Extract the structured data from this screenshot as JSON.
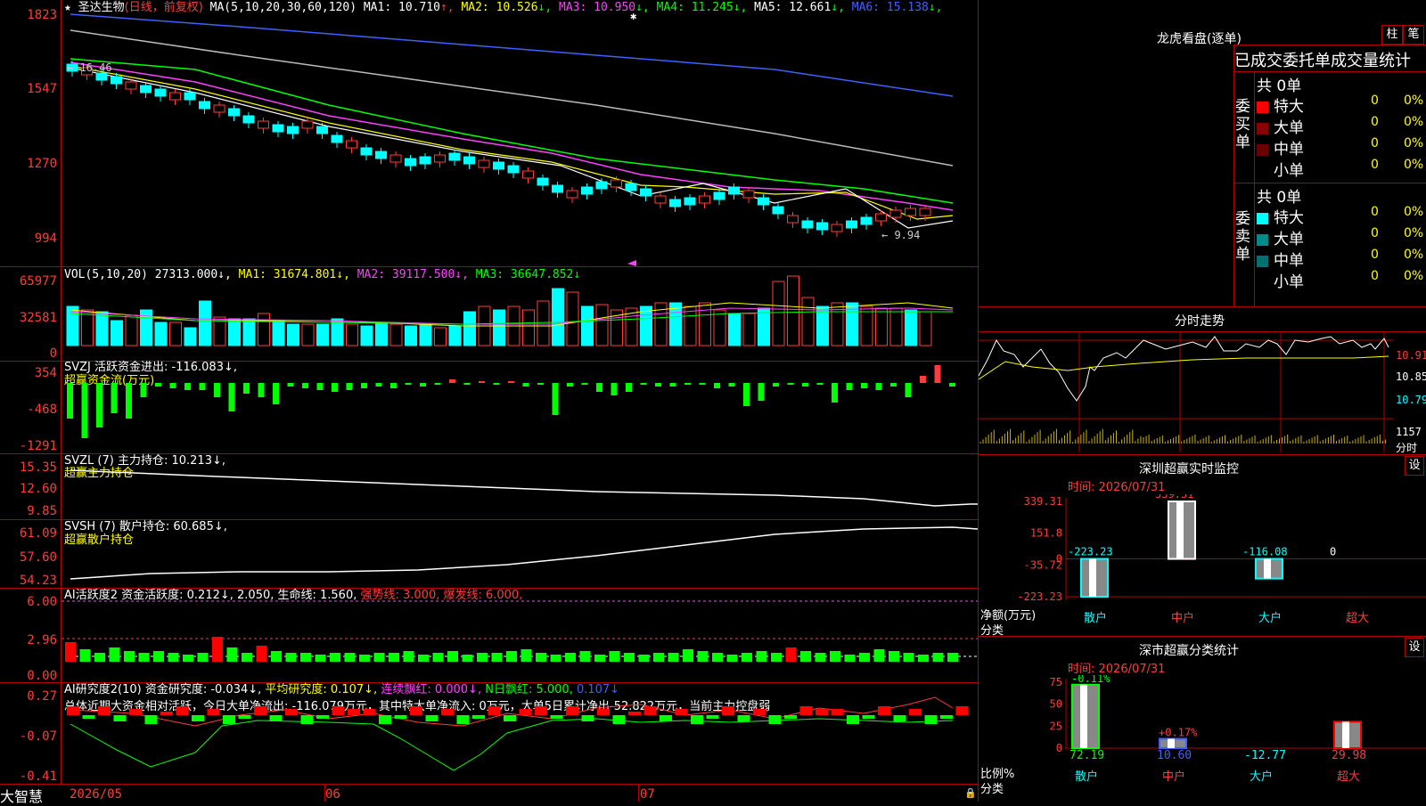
{
  "app": {
    "name": "大智慧"
  },
  "main_chart": {
    "title_prefix": "★",
    "stock": "圣达生物",
    "period": "(日线，前复权)",
    "ma_label": "MA(5,10,20,30,60,120)",
    "ma": [
      {
        "label": "MA1: 10.710",
        "arrow": "↑",
        "color": "#ffffff"
      },
      {
        "label": "MA2: 10.526",
        "arrow": "↓",
        "color": "#ffff00"
      },
      {
        "label": "MA3: 10.950",
        "arrow": "↓",
        "color": "#ff40ff"
      },
      {
        "label": "MA4: 11.245",
        "arrow": "↓",
        "color": "#00ff00"
      },
      {
        "label": "MA5: 12.661",
        "arrow": "↓",
        "color": "#ffffff"
      },
      {
        "label": "MA6: 15.138",
        "arrow": "↓",
        "color": "#4060ff"
      }
    ],
    "y_ticks": [
      "1823",
      "1547",
      "1270",
      "994"
    ],
    "high_label": "16.46",
    "low_label": "9.94"
  },
  "volume": {
    "header": "VOL(5,10,20) 27313.000↓,",
    "ma1": "MA1: 31674.801↓,",
    "ma2": "MA2: 39117.500↓,",
    "ma3": "MA3: 36647.852↓",
    "y_ticks": [
      "65977",
      "32581",
      "0"
    ]
  },
  "svzj": {
    "header": "SVZJ  活跃资金进出: -116.083↓,",
    "sub": "超赢资金流(万元)",
    "y_ticks": [
      "354",
      "-468",
      "-1291"
    ]
  },
  "svzl": {
    "header": "SVZL (7) 主力持仓: 10.213↓,",
    "sub": "超赢主力持仓",
    "y_ticks": [
      "15.35",
      "12.60",
      "9.85"
    ]
  },
  "svsh": {
    "header": "SVSH (7) 散户持仓: 60.685↓,",
    "sub": "超赢散户持仓",
    "y_ticks": [
      "61.09",
      "57.60",
      "54.23"
    ]
  },
  "ai_active": {
    "header_a": "AI活跃度2 资金活跃度: 0.212↓, 2.050, 生命线: 1.560,",
    "header_b": "强势线: 3.000, 爆发线: 6.000,",
    "y_ticks": [
      "6.00",
      "2.96",
      "0.00"
    ]
  },
  "ai_research": {
    "header_a": "AI研究度2(10) 资金研究度: -0.034↓,",
    "header_b": "平均研究度: 0.107↓,",
    "header_c": "连续飘红: 0.000↓,",
    "header_d": "N日飘红: 5.000,",
    "header_e": "0.107↓",
    "summary": "总体近期大资金相对活跃，今日大单净流出: -116.079万元，其中特大单净流入: 0万元，大单5日累计净出-52.822万元，当前主力控盘弱",
    "y_ticks": [
      "0.27",
      "-0.07",
      "-0.41"
    ]
  },
  "x_axis": {
    "labels": [
      "2026/05",
      "06",
      "07"
    ]
  },
  "lhb": {
    "title": "龙虎看盘(逐单)",
    "btn_zhu": "柱",
    "btn_bi": "笔",
    "subtitle": "已成交委托单成交量统计",
    "buy": {
      "side": "委买单",
      "total": "共 0单",
      "rows": [
        {
          "label": "特大",
          "val": "0",
          "pct": "0%",
          "color": "#ff0000"
        },
        {
          "label": "大单",
          "val": "0",
          "pct": "0%",
          "color": "#8b0000"
        },
        {
          "label": "中单",
          "val": "0",
          "pct": "0%",
          "color": "#6a0000"
        },
        {
          "label": "小单",
          "val": "0",
          "pct": "0%",
          "color": "#000000"
        }
      ]
    },
    "sell": {
      "side": "委卖单",
      "total": "共 0单",
      "rows": [
        {
          "label": "特大",
          "val": "0",
          "pct": "0%",
          "color": "#00ffff"
        },
        {
          "label": "大单",
          "val": "0",
          "pct": "0%",
          "color": "#008b8b"
        },
        {
          "label": "中单",
          "val": "0",
          "pct": "0%",
          "color": "#007070"
        },
        {
          "label": "小单",
          "val": "0",
          "pct": "0%",
          "color": "#000000"
        }
      ]
    }
  },
  "intraday": {
    "title": "分时走势",
    "prices": [
      "10.91",
      "10.85",
      "10.79"
    ],
    "vol_label": "1157",
    "vol_unit": "分时"
  },
  "sz_monitor": {
    "title": "深圳超赢实时监控",
    "btn": "设",
    "time": "时间: 2026/07/31",
    "y_ticks": [
      "339.31",
      "151.8",
      "0",
      "-35.72",
      "-223.23"
    ],
    "bars": [
      {
        "cat": "散户",
        "value": -223.23,
        "label": "-223.23",
        "label_color": "#00ffff"
      },
      {
        "cat": "中户",
        "value": 339.31,
        "label": "339.31",
        "label_color": "#ff3b3b"
      },
      {
        "cat": "大户",
        "value": -116.08,
        "label": "-116.08",
        "label_color": "#00ffff"
      },
      {
        "cat": "超大",
        "value": 0,
        "label": "0",
        "label_color": "#ffffff"
      }
    ],
    "ylabel_a": "净额(万元)",
    "ylabel_b": "分类"
  },
  "sz_class": {
    "title": "深市超赢分类统计",
    "btn": "设",
    "time": "时间: 2026/07/31",
    "y_ticks": [
      "75",
      "50",
      "25",
      "0"
    ],
    "bars": [
      {
        "cat": "散户",
        "value": 72.19,
        "label": "72.19",
        "top_label": "-0.11%",
        "top_color": "#00ff00",
        "border": "#00ff00"
      },
      {
        "cat": "中户",
        "value": 10.6,
        "label": "10.60",
        "top_label": "+0.17%",
        "top_color": "#ff3b3b",
        "border": "#4060ff"
      },
      {
        "cat": "大户",
        "value": -12.77,
        "label": "-12.77",
        "top_label": "",
        "top_color": "#00ffff",
        "border": "#00ffff"
      },
      {
        "cat": "超大",
        "value": 29.98,
        "label": "29.98",
        "top_label": "",
        "top_color": "#ff3b3b",
        "border": "#ff0000"
      }
    ],
    "ylabel_a": "比例%",
    "ylabel_b": "分类"
  },
  "colors": {
    "up": "#ff3b3b",
    "down": "#00ffff",
    "grid": "#b00000"
  }
}
